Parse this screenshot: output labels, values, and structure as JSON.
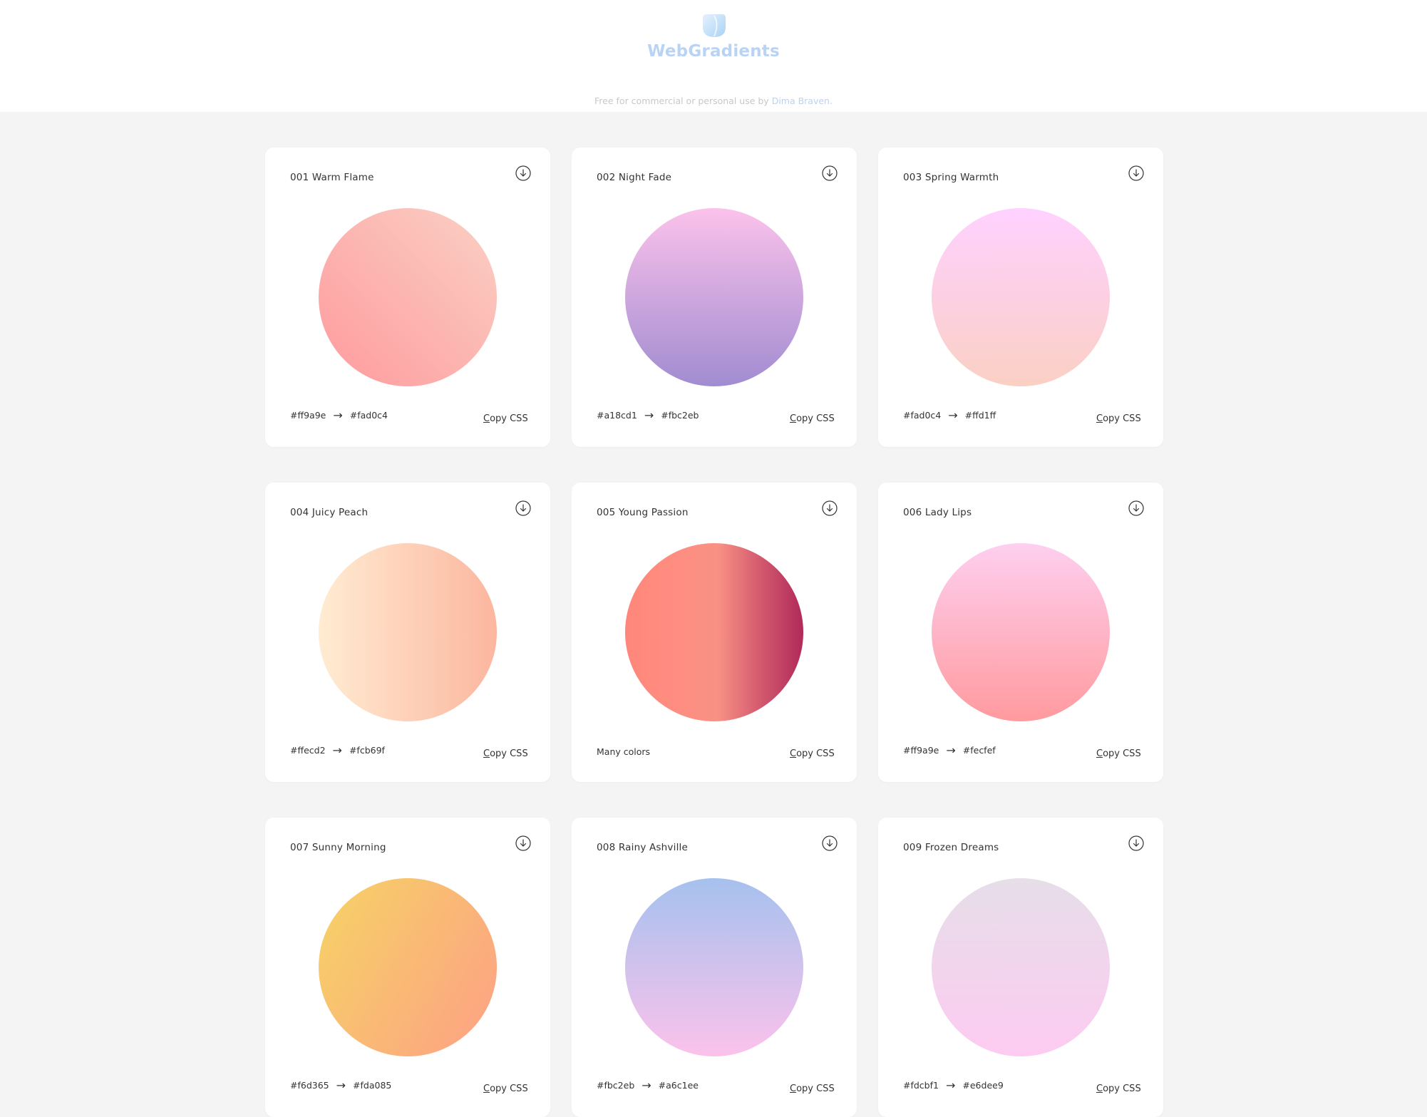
{
  "brand": {
    "name": "WebGradients",
    "logo_icon": "drop-logo-icon",
    "accent": "#b9d3f4"
  },
  "tagline": {
    "prefix": "Free for commercial or personal use by",
    "author": "Dima Braven",
    "suffix": "."
  },
  "card_labels": {
    "copy_css": "Copy CSS",
    "arrow": "→",
    "download_icon": "download-circle-icon"
  },
  "gradients": [
    {
      "title": "001 Warm Flame",
      "from": "#ff9a9e",
      "to": "#fad0c4",
      "many": false,
      "css": "linear-gradient(45deg, #ff9a9e 0%, #fad0c4 99%, #fad0c4 100%)"
    },
    {
      "title": "002 Night Fade",
      "from": "#a18cd1",
      "to": "#fbc2eb",
      "many": false,
      "css": "linear-gradient(to top, #a18cd1 0%, #fbc2eb 100%)"
    },
    {
      "title": "003 Spring Warmth",
      "from": "#fad0c4",
      "to": "#ffd1ff",
      "many": false,
      "css": "linear-gradient(to top, #fad0c4 0%, #ffd1ff 100%)"
    },
    {
      "title": "004 Juicy Peach",
      "from": "#ffecd2",
      "to": "#fcb69f",
      "many": false,
      "css": "linear-gradient(to right, #ffecd2 0%, #fcb69f 100%)"
    },
    {
      "title": "005 Young Passion",
      "from": "",
      "to": "",
      "many": true,
      "many_label": "Many colors",
      "css": "linear-gradient(to right, #ff8177 0%, #ff867a 0%, #ff8c7f 21%, #f99185 52%, #cf556c 78%, #b12a5b 100%)"
    },
    {
      "title": "006 Lady Lips",
      "from": "#ff9a9e",
      "to": "#fecfef",
      "many": false,
      "css": "linear-gradient(to top, #ff9a9e 0%, #fecfef 99%, #fecfef 100%)"
    },
    {
      "title": "007 Sunny Morning",
      "from": "#f6d365",
      "to": "#fda085",
      "many": false,
      "css": "linear-gradient(120deg, #f6d365 0%, #fda085 100%)"
    },
    {
      "title": "008 Rainy Ashville",
      "from": "#fbc2eb",
      "to": "#a6c1ee",
      "many": false,
      "css": "linear-gradient(to top, #fbc2eb 0%, #a6c1ee 100%)"
    },
    {
      "title": "009 Frozen Dreams",
      "from": "#fdcbf1",
      "to": "#e6dee9",
      "many": false,
      "css": "linear-gradient(to top, #fdcbf1 0%, #fdcbf1 1%, #e6dee9 100%)"
    }
  ]
}
